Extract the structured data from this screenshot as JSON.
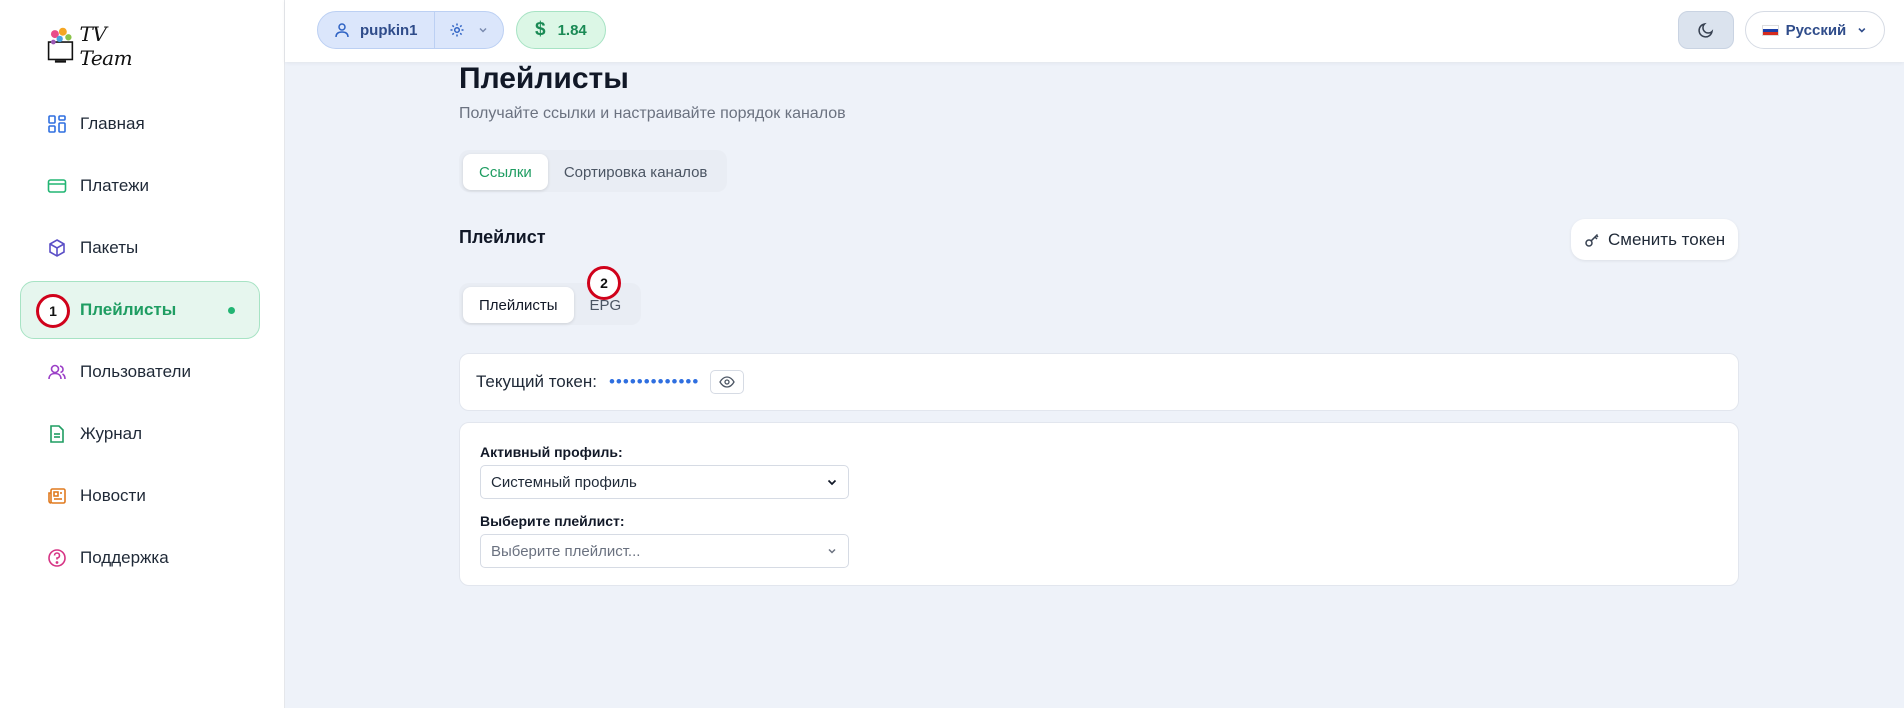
{
  "brand": {
    "logo_text": "TV Team"
  },
  "sidebar": {
    "items": [
      {
        "label": "Главная",
        "icon": "dashboard-icon",
        "color": "#2f6fe0"
      },
      {
        "label": "Платежи",
        "icon": "credit-card-icon",
        "color": "#22b573"
      },
      {
        "label": "Пакеты",
        "icon": "package-icon",
        "color": "#5b4fc7"
      },
      {
        "label": "Плейлисты",
        "icon": "playlist-icon",
        "color": "#1f9d62",
        "active": true
      },
      {
        "label": "Пользователи",
        "icon": "users-icon",
        "color": "#9b3fc7"
      },
      {
        "label": "Журнал",
        "icon": "document-icon",
        "color": "#1f9d62"
      },
      {
        "label": "Новости",
        "icon": "newspaper-icon",
        "color": "#e07a1f"
      },
      {
        "label": "Поддержка",
        "icon": "help-circle-icon",
        "color": "#d63384"
      }
    ]
  },
  "markers": {
    "m1": "1",
    "m2": "2"
  },
  "topbar": {
    "username": "pupkin1",
    "balance": "1.84",
    "balance_currency": "$",
    "language": "Русский"
  },
  "page": {
    "title": "Плейлисты",
    "subtitle": "Получайте ссылки и настраивайте порядок каналов",
    "tabs": [
      {
        "label": "Ссылки",
        "active": true
      },
      {
        "label": "Сортировка каналов",
        "active": false
      }
    ],
    "section_title": "Плейлист",
    "change_token_label": "Сменить токен",
    "subtabs": [
      {
        "label": "Плейлисты",
        "active": true
      },
      {
        "label": "EPG",
        "active": false
      }
    ],
    "token_label": "Текущий токен:",
    "token_mask": "•••••••••••••",
    "active_profile_label": "Активный профиль:",
    "active_profile_value": "Системный профиль",
    "playlist_label": "Выберите плейлист:",
    "playlist_placeholder": "Выберите плейлист..."
  },
  "colors": {
    "accent_green": "#1f9d62",
    "accent_blue": "#2f6fe0",
    "marker_red": "#d0021b"
  }
}
